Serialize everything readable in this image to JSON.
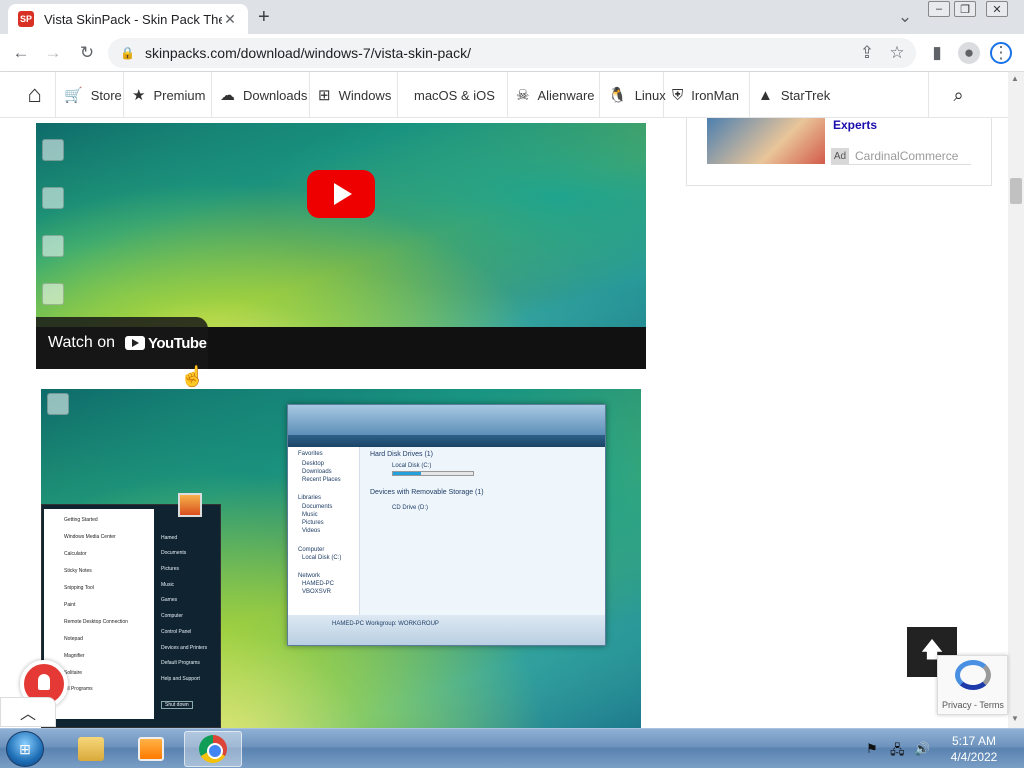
{
  "browser": {
    "tab_title": "Vista SkinPack - Skin Pack Theme",
    "tab_favicon": "SP",
    "tab_close": "✕",
    "new_tab": "+",
    "url": "skinpacks.com/download/windows-7/vista-skin-pack/"
  },
  "site_nav": {
    "items": [
      {
        "label": "Store",
        "icon": "cart-icon"
      },
      {
        "label": "Premium",
        "icon": "star-icon"
      },
      {
        "label": "Downloads",
        "icon": "cloud-download-icon"
      },
      {
        "label": "Windows",
        "icon": "windows-logo-icon"
      },
      {
        "label": "macOS & iOS",
        "icon": "apple-icon"
      },
      {
        "label": "Alienware",
        "icon": "alien-icon"
      },
      {
        "label": "Linux",
        "icon": "tux-icon"
      },
      {
        "label": "IronMan",
        "icon": "ironman-icon"
      },
      {
        "label": "StarTrek",
        "icon": "startrek-icon"
      }
    ]
  },
  "video": {
    "watch_on": "Watch on",
    "youtube": "YouTube"
  },
  "screenshot": {
    "explorer": {
      "section_hdd": "Hard Disk Drives (1)",
      "local_disk": "Local Disk (C:)",
      "section_removable": "Devices with Removable Storage (1)",
      "cd_drive": "CD Drive (D:)",
      "nav": [
        "Favorites",
        "Desktop",
        "Downloads",
        "Recent Places",
        "Libraries",
        "Documents",
        "Music",
        "Pictures",
        "Videos",
        "Computer",
        "Local Disk (C:)",
        "Network",
        "HAMED-PC",
        "VBOXSVR"
      ],
      "status": "HAMED-PC  Workgroup: WORKGROUP"
    },
    "start_menu": {
      "left": [
        "Getting Started",
        "Windows Media Center",
        "Calculator",
        "Sticky Notes",
        "Snipping Tool",
        "Paint",
        "Remote Desktop Connection",
        "Notepad",
        "Magnifier",
        "Solitaire",
        "All Programs"
      ],
      "right": [
        "Hamed",
        "Documents",
        "Pictures",
        "Music",
        "Games",
        "Computer",
        "Control Panel",
        "Devices and Printers",
        "Default Programs",
        "Help and Support"
      ],
      "shutdown": "Shut down"
    }
  },
  "ad": {
    "title": "Experts",
    "badge": "Ad",
    "source": "CardinalCommerce"
  },
  "recaptcha": {
    "links": "Privacy - Terms"
  },
  "taskbar": {
    "time": "5:17 AM",
    "date": "4/4/2022"
  },
  "colors": {
    "youtube_red": "#e00000",
    "link_blue": "#1a0dab",
    "notification_red": "#e53935"
  }
}
